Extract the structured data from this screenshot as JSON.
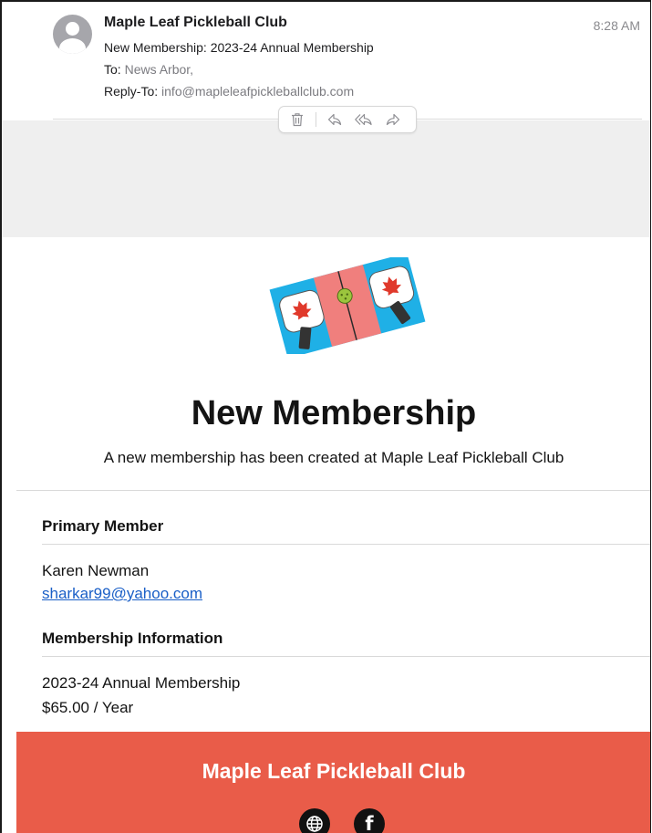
{
  "mail": {
    "sender": "Maple Leaf Pickleball Club",
    "time": "8:28 AM",
    "subject": "New Membership: 2023-24 Annual Membership",
    "to_label": "To:",
    "to_value": "News Arbor,",
    "reply_label": "Reply-To:",
    "reply_value": "info@mapleleafpickleballclub.com"
  },
  "toolbar": {
    "icons": [
      "trash-icon",
      "reply-icon",
      "reply-all-icon",
      "forward-icon"
    ]
  },
  "email": {
    "logo_icon": "pickleball-paddles-logo",
    "title": "New Membership",
    "subtitle": "A new membership has been created at Maple Leaf Pickleball Club",
    "primary_heading": "Primary Member",
    "member_name": "Karen Newman",
    "member_email": "sharkar99@yahoo.com",
    "membership_heading": "Membership Information",
    "membership_name": "2023-24 Annual Membership",
    "membership_price": "$65.00 / Year",
    "footer_title": "Maple Leaf Pickleball Club",
    "social_icons": [
      "globe-icon",
      "facebook-icon"
    ],
    "facebook_letter": "f"
  },
  "colors": {
    "footer": "#e95c49",
    "link": "#1a5fc7",
    "grey_band": "#efefef",
    "logo_blue": "#1fb0e6",
    "logo_pink": "#f07f7d",
    "logo_maple": "#e0392b",
    "ball": "#9bc53d"
  }
}
